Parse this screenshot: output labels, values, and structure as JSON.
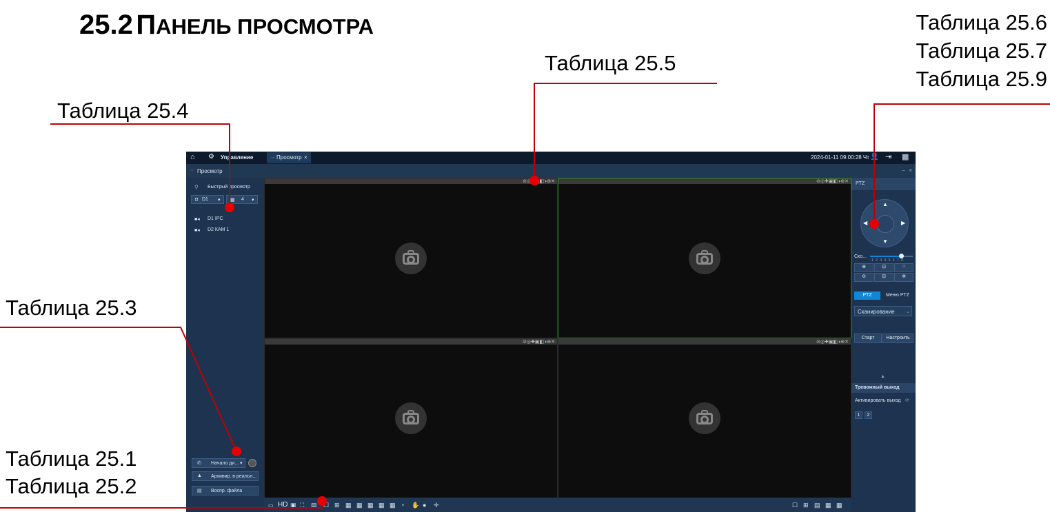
{
  "heading": {
    "number": "25.2",
    "first_letter": "П",
    "rest": "анель просмотра"
  },
  "refs": {
    "t255": "Таблица 25.5",
    "t256": "Таблица 25.6",
    "t257": "Таблица 25.7",
    "t259": "Таблица 25.9",
    "t254": "Таблица 25.4",
    "t253": "Таблица 25.3",
    "t251": "Таблица 25.1",
    "t252": "Таблица 25.2"
  },
  "app": {
    "topbar": {
      "management": "Управление",
      "tab": "Просмотр",
      "datetime": "2024-01-11 09:00:28 Чт"
    },
    "titlebar": {
      "title": "Просмотр"
    },
    "left": {
      "quick_view": "Быстрый просмотр",
      "channel": "D1",
      "layout": "4",
      "channels": [
        "D1 IPC",
        "D2 КАМ 1"
      ],
      "start_dialog": "Начало ди...",
      "archive_realtime": "Архивир. в реальн...",
      "play_file": "Воспр. файла"
    },
    "ptz": {
      "header": "PTZ",
      "speed_label": "Ско...",
      "speed_ticks": "1 2 3 4 5 6 7 8",
      "speed_value": 0.72,
      "tab_ptz": "PTZ",
      "tab_menu": "Меню PTZ",
      "mode": "Сканирование",
      "start_btn": "Старт",
      "config_btn": "Настроить",
      "alarm_header": "Тревожный выход",
      "activate_output": "Активировать выход",
      "outputs": [
        "1",
        "2"
      ]
    },
    "bottombar": {
      "hd": "HD"
    }
  },
  "colors": {
    "accent": "#0f86d8",
    "marker": "#e60000",
    "selected_border": "#2e8b2e"
  }
}
